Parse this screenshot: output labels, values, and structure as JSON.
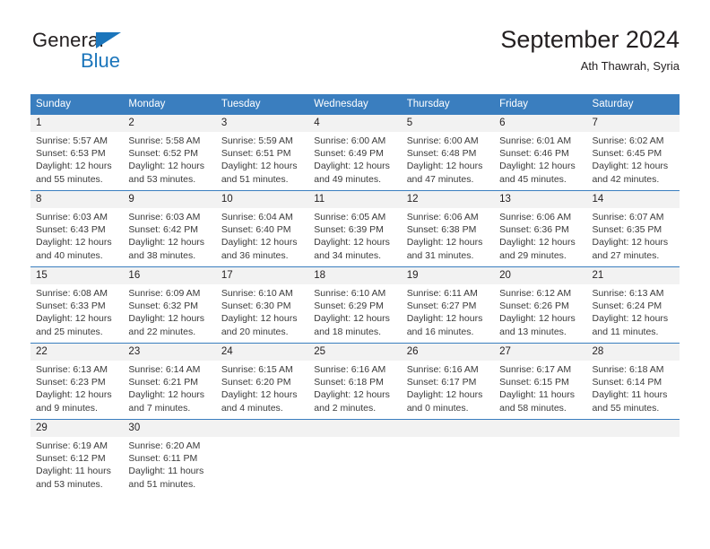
{
  "brand": {
    "name_part1": "General",
    "name_part2": "Blue",
    "accent_color": "#1b75bb"
  },
  "header": {
    "title": "September 2024",
    "location": "Ath Thawrah, Syria"
  },
  "theme": {
    "header_blue": "#3a7ebf",
    "daynum_band": "#f2f2f2"
  },
  "weekdays": [
    "Sunday",
    "Monday",
    "Tuesday",
    "Wednesday",
    "Thursday",
    "Friday",
    "Saturday"
  ],
  "weeks": [
    [
      {
        "day": "1",
        "sunrise": "Sunrise: 5:57 AM",
        "sunset": "Sunset: 6:53 PM",
        "daylight1": "Daylight: 12 hours",
        "daylight2": "and 55 minutes."
      },
      {
        "day": "2",
        "sunrise": "Sunrise: 5:58 AM",
        "sunset": "Sunset: 6:52 PM",
        "daylight1": "Daylight: 12 hours",
        "daylight2": "and 53 minutes."
      },
      {
        "day": "3",
        "sunrise": "Sunrise: 5:59 AM",
        "sunset": "Sunset: 6:51 PM",
        "daylight1": "Daylight: 12 hours",
        "daylight2": "and 51 minutes."
      },
      {
        "day": "4",
        "sunrise": "Sunrise: 6:00 AM",
        "sunset": "Sunset: 6:49 PM",
        "daylight1": "Daylight: 12 hours",
        "daylight2": "and 49 minutes."
      },
      {
        "day": "5",
        "sunrise": "Sunrise: 6:00 AM",
        "sunset": "Sunset: 6:48 PM",
        "daylight1": "Daylight: 12 hours",
        "daylight2": "and 47 minutes."
      },
      {
        "day": "6",
        "sunrise": "Sunrise: 6:01 AM",
        "sunset": "Sunset: 6:46 PM",
        "daylight1": "Daylight: 12 hours",
        "daylight2": "and 45 minutes."
      },
      {
        "day": "7",
        "sunrise": "Sunrise: 6:02 AM",
        "sunset": "Sunset: 6:45 PM",
        "daylight1": "Daylight: 12 hours",
        "daylight2": "and 42 minutes."
      }
    ],
    [
      {
        "day": "8",
        "sunrise": "Sunrise: 6:03 AM",
        "sunset": "Sunset: 6:43 PM",
        "daylight1": "Daylight: 12 hours",
        "daylight2": "and 40 minutes."
      },
      {
        "day": "9",
        "sunrise": "Sunrise: 6:03 AM",
        "sunset": "Sunset: 6:42 PM",
        "daylight1": "Daylight: 12 hours",
        "daylight2": "and 38 minutes."
      },
      {
        "day": "10",
        "sunrise": "Sunrise: 6:04 AM",
        "sunset": "Sunset: 6:40 PM",
        "daylight1": "Daylight: 12 hours",
        "daylight2": "and 36 minutes."
      },
      {
        "day": "11",
        "sunrise": "Sunrise: 6:05 AM",
        "sunset": "Sunset: 6:39 PM",
        "daylight1": "Daylight: 12 hours",
        "daylight2": "and 34 minutes."
      },
      {
        "day": "12",
        "sunrise": "Sunrise: 6:06 AM",
        "sunset": "Sunset: 6:38 PM",
        "daylight1": "Daylight: 12 hours",
        "daylight2": "and 31 minutes."
      },
      {
        "day": "13",
        "sunrise": "Sunrise: 6:06 AM",
        "sunset": "Sunset: 6:36 PM",
        "daylight1": "Daylight: 12 hours",
        "daylight2": "and 29 minutes."
      },
      {
        "day": "14",
        "sunrise": "Sunrise: 6:07 AM",
        "sunset": "Sunset: 6:35 PM",
        "daylight1": "Daylight: 12 hours",
        "daylight2": "and 27 minutes."
      }
    ],
    [
      {
        "day": "15",
        "sunrise": "Sunrise: 6:08 AM",
        "sunset": "Sunset: 6:33 PM",
        "daylight1": "Daylight: 12 hours",
        "daylight2": "and 25 minutes."
      },
      {
        "day": "16",
        "sunrise": "Sunrise: 6:09 AM",
        "sunset": "Sunset: 6:32 PM",
        "daylight1": "Daylight: 12 hours",
        "daylight2": "and 22 minutes."
      },
      {
        "day": "17",
        "sunrise": "Sunrise: 6:10 AM",
        "sunset": "Sunset: 6:30 PM",
        "daylight1": "Daylight: 12 hours",
        "daylight2": "and 20 minutes."
      },
      {
        "day": "18",
        "sunrise": "Sunrise: 6:10 AM",
        "sunset": "Sunset: 6:29 PM",
        "daylight1": "Daylight: 12 hours",
        "daylight2": "and 18 minutes."
      },
      {
        "day": "19",
        "sunrise": "Sunrise: 6:11 AM",
        "sunset": "Sunset: 6:27 PM",
        "daylight1": "Daylight: 12 hours",
        "daylight2": "and 16 minutes."
      },
      {
        "day": "20",
        "sunrise": "Sunrise: 6:12 AM",
        "sunset": "Sunset: 6:26 PM",
        "daylight1": "Daylight: 12 hours",
        "daylight2": "and 13 minutes."
      },
      {
        "day": "21",
        "sunrise": "Sunrise: 6:13 AM",
        "sunset": "Sunset: 6:24 PM",
        "daylight1": "Daylight: 12 hours",
        "daylight2": "and 11 minutes."
      }
    ],
    [
      {
        "day": "22",
        "sunrise": "Sunrise: 6:13 AM",
        "sunset": "Sunset: 6:23 PM",
        "daylight1": "Daylight: 12 hours",
        "daylight2": "and 9 minutes."
      },
      {
        "day": "23",
        "sunrise": "Sunrise: 6:14 AM",
        "sunset": "Sunset: 6:21 PM",
        "daylight1": "Daylight: 12 hours",
        "daylight2": "and 7 minutes."
      },
      {
        "day": "24",
        "sunrise": "Sunrise: 6:15 AM",
        "sunset": "Sunset: 6:20 PM",
        "daylight1": "Daylight: 12 hours",
        "daylight2": "and 4 minutes."
      },
      {
        "day": "25",
        "sunrise": "Sunrise: 6:16 AM",
        "sunset": "Sunset: 6:18 PM",
        "daylight1": "Daylight: 12 hours",
        "daylight2": "and 2 minutes."
      },
      {
        "day": "26",
        "sunrise": "Sunrise: 6:16 AM",
        "sunset": "Sunset: 6:17 PM",
        "daylight1": "Daylight: 12 hours",
        "daylight2": "and 0 minutes."
      },
      {
        "day": "27",
        "sunrise": "Sunrise: 6:17 AM",
        "sunset": "Sunset: 6:15 PM",
        "daylight1": "Daylight: 11 hours",
        "daylight2": "and 58 minutes."
      },
      {
        "day": "28",
        "sunrise": "Sunrise: 6:18 AM",
        "sunset": "Sunset: 6:14 PM",
        "daylight1": "Daylight: 11 hours",
        "daylight2": "and 55 minutes."
      }
    ],
    [
      {
        "day": "29",
        "sunrise": "Sunrise: 6:19 AM",
        "sunset": "Sunset: 6:12 PM",
        "daylight1": "Daylight: 11 hours",
        "daylight2": "and 53 minutes."
      },
      {
        "day": "30",
        "sunrise": "Sunrise: 6:20 AM",
        "sunset": "Sunset: 6:11 PM",
        "daylight1": "Daylight: 11 hours",
        "daylight2": "and 51 minutes."
      },
      {
        "day": "",
        "sunrise": "",
        "sunset": "",
        "daylight1": "",
        "daylight2": ""
      },
      {
        "day": "",
        "sunrise": "",
        "sunset": "",
        "daylight1": "",
        "daylight2": ""
      },
      {
        "day": "",
        "sunrise": "",
        "sunset": "",
        "daylight1": "",
        "daylight2": ""
      },
      {
        "day": "",
        "sunrise": "",
        "sunset": "",
        "daylight1": "",
        "daylight2": ""
      },
      {
        "day": "",
        "sunrise": "",
        "sunset": "",
        "daylight1": "",
        "daylight2": ""
      }
    ]
  ]
}
